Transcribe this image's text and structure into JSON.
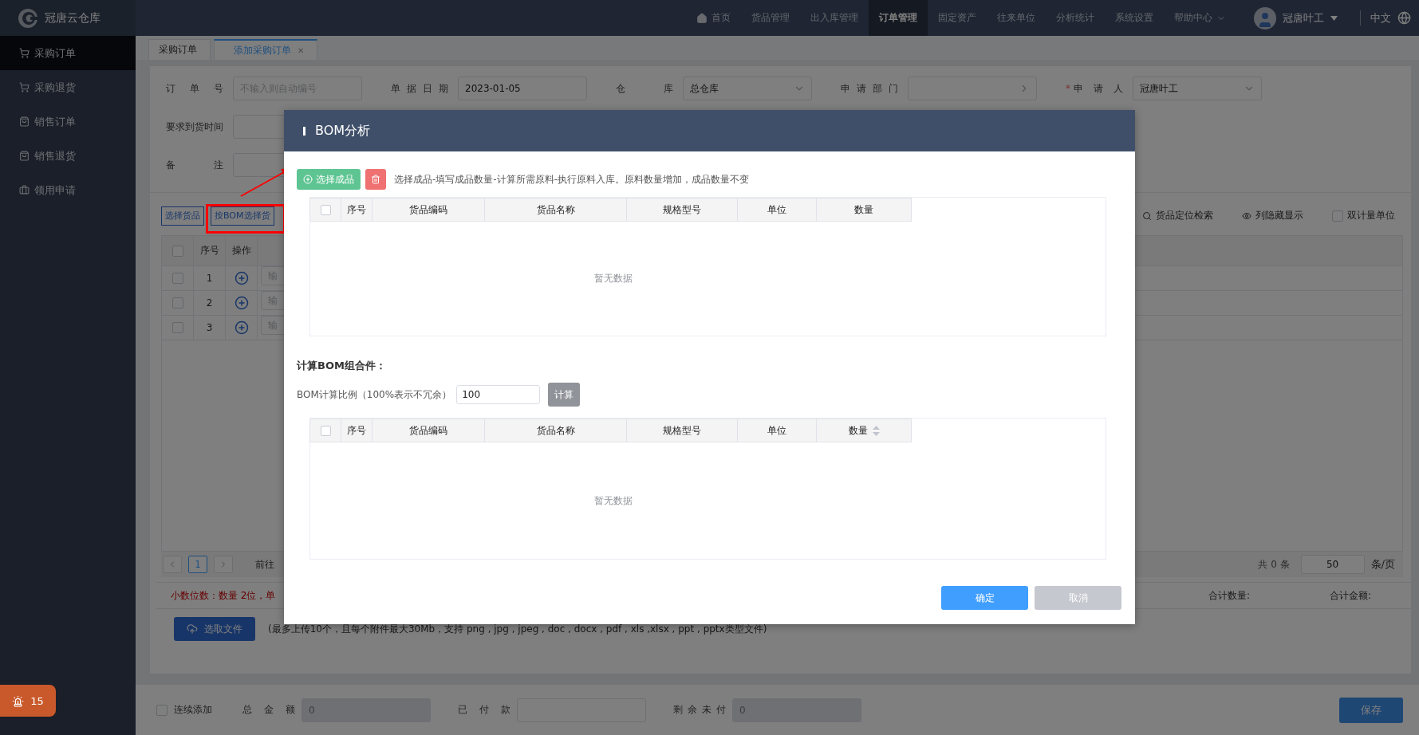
{
  "brand": {
    "name": "冠唐云仓库"
  },
  "nav": [
    {
      "label": "首页",
      "selected": false,
      "kind": "home"
    },
    {
      "label": "货品管理",
      "selected": false,
      "kind": "link"
    },
    {
      "label": "出入库管理",
      "selected": false,
      "kind": "link"
    },
    {
      "label": "订单管理",
      "selected": true,
      "kind": "link"
    },
    {
      "label": "固定资产",
      "selected": false,
      "kind": "link"
    },
    {
      "label": "往来单位",
      "selected": false,
      "kind": "link"
    },
    {
      "label": "分析统计",
      "selected": false,
      "kind": "link"
    },
    {
      "label": "系统设置",
      "selected": false,
      "kind": "link"
    },
    {
      "label": "帮助中心",
      "selected": false,
      "kind": "menu"
    }
  ],
  "user": {
    "name": "冠唐叶工"
  },
  "language": {
    "label": "中文"
  },
  "sidebar": [
    {
      "label": "采购订单",
      "selected": true,
      "kind": "cart"
    },
    {
      "label": "采购退货",
      "selected": false,
      "kind": "cart"
    },
    {
      "label": "销售订单",
      "selected": false,
      "kind": "bag"
    },
    {
      "label": "销售退货",
      "selected": false,
      "kind": "bag"
    },
    {
      "label": "领用申请",
      "selected": false,
      "kind": "case"
    }
  ],
  "tabs": [
    {
      "label": "采购订单",
      "selected": false
    },
    {
      "label": "添加采购订单",
      "selected": true,
      "close_label": "✕"
    }
  ],
  "form": {
    "rows": [
      [
        {
          "label": "订单号",
          "placeholder": "不输入则自动编号",
          "kind": "text"
        },
        {
          "label": "单据日期",
          "value": "2023-01-05",
          "kind": "text"
        },
        {
          "label": "仓库",
          "value": "总仓库",
          "kind": "select"
        },
        {
          "label": "申请部门",
          "kind": "cascade"
        },
        {
          "label": "申请人",
          "value": "冠唐叶工",
          "kind": "select",
          "required_mark": "*"
        }
      ],
      [
        {
          "label": "要求到货时间",
          "kind": "text"
        }
      ],
      [
        {
          "label": "备注",
          "kind": "text"
        }
      ]
    ]
  },
  "toolbar": {
    "buttons": [
      "选择货品",
      "按BOM选择货"
    ],
    "tools": [
      {
        "label": "货品定位检索",
        "kind": "search"
      },
      {
        "label": "列隐藏显示",
        "kind": "eye"
      },
      {
        "label": "双计量单位",
        "kind": "checkbox",
        "checked": false
      }
    ]
  },
  "items_table": {
    "all_checked": false,
    "columns": [
      "序号",
      "操作"
    ],
    "rows": [
      {
        "index": "1",
        "placeholder": "输",
        "checked": false
      },
      {
        "index": "2",
        "placeholder": "输",
        "checked": false
      },
      {
        "index": "3",
        "placeholder": "输",
        "checked": false
      }
    ]
  },
  "pagination": {
    "page": "1",
    "goto_label": "前往",
    "total": "共 0 条",
    "page_size": "50",
    "per_page_label": "条/页"
  },
  "decimals_note": "小数位数：数量 2位，单",
  "totals": [
    "合计数量:",
    "合计金额:"
  ],
  "upload": {
    "button": "选取文件",
    "hint": "(最多上传10个，且每个附件最大30Mb，支持 png , jpg , jpeg , doc , docx , pdf , xls ,xlsx , ppt , pptx类型文件)"
  },
  "footer": {
    "continuous_add": {
      "label": "连续添加",
      "checked": false
    },
    "fields": [
      {
        "label": "总金额",
        "value": "0",
        "disabled": true
      },
      {
        "label": "已付款",
        "disabled": false
      },
      {
        "label": "剩余未付",
        "value": "0",
        "disabled": true
      }
    ],
    "save": "保存"
  },
  "alarm": {
    "count": "15"
  },
  "modal": {
    "title": "BOM分析",
    "pick_button": "选择成品",
    "hint": "选择成品-填写成品数量-计算所需原料-执行原料入库。原料数量增加，成品数量不变",
    "products_table": {
      "all_checked": false,
      "empty_text": "暂无数据",
      "columns": [
        {
          "label": "序号",
          "sortable": false
        },
        {
          "label": "货品编码",
          "sortable": false
        },
        {
          "label": "货品名称",
          "sortable": false
        },
        {
          "label": "规格型号",
          "sortable": false
        },
        {
          "label": "单位",
          "sortable": false
        },
        {
          "label": "数量",
          "sortable": false
        }
      ]
    },
    "section_title": "计算BOM组合件：",
    "ratio": {
      "label": "BOM计算比例（100%表示不冗余）",
      "value": "100"
    },
    "calculate_button": "计算",
    "components_table": {
      "all_checked": false,
      "empty_text": "暂无数据",
      "columns": [
        {
          "label": "序号",
          "sortable": false
        },
        {
          "label": "货品编码",
          "sortable": false
        },
        {
          "label": "货品名称",
          "sortable": false
        },
        {
          "label": "规格型号",
          "sortable": false
        },
        {
          "label": "单位",
          "sortable": false
        },
        {
          "label": "数量",
          "sortable": true
        }
      ]
    },
    "buttons": [
      {
        "label": "确定",
        "kind": "primary"
      },
      {
        "label": "取消",
        "kind": "secondary"
      }
    ]
  }
}
